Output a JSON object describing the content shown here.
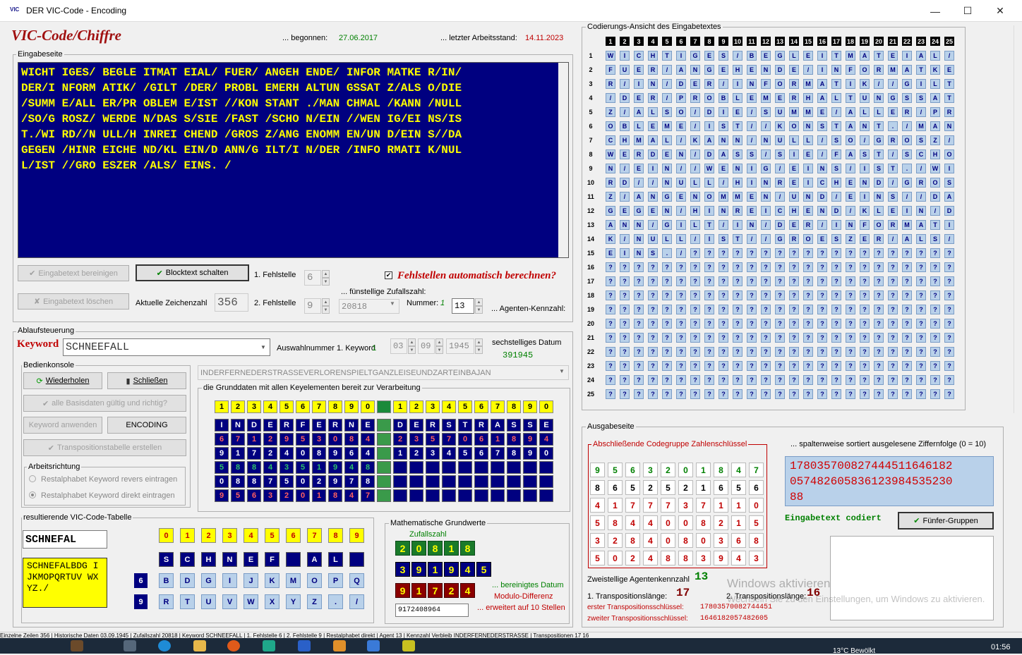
{
  "window": {
    "title": "DER VIC-Code - Encoding",
    "app_icon": "VIC",
    "minimize": "—",
    "maximize": "☐",
    "close": "✕"
  },
  "header": {
    "title": "VIC-Code/Chiffre",
    "begun_label": "... begonnen:",
    "begun_date": "27.06.2017",
    "last_label": "... letzter Arbeitsstand:",
    "last_date": "14.11.2023"
  },
  "input_page": {
    "label": "Eingabeseite",
    "lines": [
      "WICHT IGES/ BEGLE ITMAT EIAL/ FUER/ ANGEH ENDE/ INFOR MATKE R/IN/",
      "DER/I NFORM ATIK/ /GILT /DER/ PROBL EMERH ALTUN GSSAT Z/ALS O/DIE",
      "/SUMM E/ALL ER/PR OBLEM E/IST //KON STANT ./MAN CHMAL /KANN /NULL",
      "/SO/G ROSZ/ WERDE N/DAS S/SIE /FAST /SCHO N/EIN //WEN IG/EI NS/IS",
      "T./WI RD//N ULL/H INREI CHEND /GROS Z/ANG ENOMM EN/UN D/EIN S//DA",
      "GEGEN /HINR EICHE ND/KL EIN/D ANN/G ILT/I N/DER /INFO RMATI K/NUL",
      "L/IST //GRO ESZER /ALS/ EINS. /"
    ]
  },
  "controls": {
    "clean_btn": "Eingabetext bereinigen",
    "block_btn": "Blocktext schalten",
    "delete_btn": "Eingabetext löschen",
    "char_count_label": "Aktuelle Zeichenzahl",
    "char_count": "356",
    "err1_label": "1. Fehlstelle",
    "err1": "6",
    "err2_label": "2. Fehlstelle",
    "err2": "9",
    "auto_label": "Fehlstellen automatisch berechnen?",
    "random_label": "... fünstellige Zufallszahl:",
    "random": "20818",
    "number_label": "Nummer:",
    "number": "1",
    "agent_value": "13",
    "agent_label": "... Agenten-Kennzahl:"
  },
  "flow": {
    "label": "Ablaufsteuerung",
    "keyword_label": "Keyword",
    "keyword": "SCHNEEFALL",
    "auswahl_label": "Auswahlnummer 1. Keyword",
    "auswahl": "1",
    "date_d": "03",
    "date_m": "09",
    "date_y": "1945",
    "date6_label": "sechstelliges Datum",
    "date6": "391945"
  },
  "console": {
    "label": "Bedienkonsole",
    "repeat": "Wiederholen",
    "close": "Schließen",
    "valid": "alle Basisdaten gültig und richtig?",
    "apply": "Keyword anwenden",
    "encoding": "ENCODING",
    "transpose": "Transpositionstabelle erstellen",
    "dir_label": "Arbeitsrichtung",
    "radio1": "Restalphabet Keyword revers eintragen",
    "radio2": "Restalphabet Keyword direkt eintragen"
  },
  "phrase": "INDERFERNEDERSTRASSEVERLORENSPIELTGANZLEISEUNDZARTEINBAJAN",
  "grund": {
    "label": "die Grunddaten mit allen Keyelementen bereit zur Verarbeitung",
    "head": [
      "1",
      "2",
      "3",
      "4",
      "5",
      "6",
      "7",
      "8",
      "9",
      "0",
      "",
      "1",
      "2",
      "3",
      "4",
      "5",
      "6",
      "7",
      "8",
      "9",
      "0"
    ],
    "rows": [
      [
        "I",
        "N",
        "D",
        "E",
        "R",
        "F",
        "E",
        "R",
        "N",
        "E",
        "",
        "D",
        "E",
        "R",
        "S",
        "T",
        "R",
        "A",
        "S",
        "S",
        "E"
      ],
      [
        "6",
        "7",
        "1",
        "2",
        "9",
        "5",
        "3",
        "0",
        "8",
        "4",
        "",
        "2",
        "3",
        "5",
        "7",
        "0",
        "6",
        "1",
        "8",
        "9",
        "4"
      ],
      [
        "9",
        "1",
        "7",
        "2",
        "4",
        "0",
        "8",
        "9",
        "6",
        "4",
        "",
        "1",
        "2",
        "3",
        "4",
        "5",
        "6",
        "7",
        "8",
        "9",
        "0"
      ],
      [
        "5",
        "8",
        "8",
        "4",
        "3",
        "5",
        "1",
        "9",
        "4",
        "8",
        "",
        "",
        "",
        "",
        "",
        "",
        "",
        "",
        "",
        "",
        ""
      ],
      [
        "0",
        "8",
        "8",
        "7",
        "5",
        "0",
        "2",
        "9",
        "7",
        "8",
        "",
        "",
        "",
        "",
        "",
        "",
        "",
        "",
        "",
        "",
        ""
      ],
      [
        "9",
        "5",
        "6",
        "3",
        "2",
        "0",
        "1",
        "8",
        "4",
        "7",
        "",
        "",
        "",
        "",
        "",
        "",
        "",
        "",
        "",
        "",
        ""
      ]
    ]
  },
  "vic_table": {
    "label": "resultierende VIC-Code-Tabelle",
    "keyword": "SCHNEFAL",
    "alphabet": "SCHNEFALBDG IJKMOPQRTUV WXYZ./",
    "head": [
      "0",
      "1",
      "2",
      "3",
      "4",
      "5",
      "6",
      "7",
      "8",
      "9"
    ],
    "row0": [
      "S",
      "C",
      "H",
      "N",
      "E",
      "F",
      "",
      "A",
      "L",
      ""
    ],
    "row6_key": "6",
    "row6": [
      "B",
      "D",
      "G",
      "I",
      "J",
      "K",
      "M",
      "O",
      "P",
      "Q"
    ],
    "row9_key": "9",
    "row9": [
      "R",
      "T",
      "U",
      "V",
      "W",
      "X",
      "Y",
      "Z",
      ".",
      "/"
    ]
  },
  "math": {
    "label": "Mathematische Grundwerte",
    "zufall_label": "Zufallszahl",
    "zufall": [
      "2",
      "0",
      "8",
      "1",
      "8"
    ],
    "datum": [
      "3",
      "9",
      "1",
      "9",
      "4",
      "5"
    ],
    "datum_label": "... bereinigtes Datum",
    "modulo": [
      "9",
      "1",
      "7",
      "2",
      "4"
    ],
    "modulo_label": "Modulo-Differenz",
    "ext": "9172408964",
    "ext_label": "... erweitert auf 10 Stellen"
  },
  "coding": {
    "label": "Codierungs-Ansicht des Eingabetextes",
    "cols": [
      "1",
      "2",
      "3",
      "4",
      "5",
      "6",
      "7",
      "8",
      "9",
      "10",
      "11",
      "12",
      "13",
      "14",
      "15",
      "16",
      "17",
      "18",
      "19",
      "20",
      "21",
      "22",
      "23",
      "24",
      "25"
    ],
    "rows": [
      "WICHTIGES/BEGLEITMATEIAL/",
      "FUER/ANGEHENDE/INFORMATKE",
      "R/IN/DER/INFORMATIK//GILT",
      "/DER/PROBLEMERHALTUNGSSAT",
      "Z/ALSO/DIE/SUMME/ALLER/PR",
      "OBLEME/IST//KONSTANT./MAN",
      "CHMAL/KANN/NULL/SO/GROSZ/",
      "WERDEN/DASS/SIE/FAST/SCHO",
      "N/EIN//WENIG/EINS/IST./WI",
      "RD//NULL/HINREICHEND/GROS",
      "Z/ANGENOMMEN/UND/EINS//DA",
      "GEGEN/HINREICHEND/KLEIN/D",
      "ANN/GILT/IN/DER/INFORMATI",
      "K/NULL/IST//GROESZER/ALS/",
      "EINS./??????????????????",
      "?????????????????????????",
      "?????????????????????????",
      "?????????????????????????",
      "?????????????????????????",
      "?????????????????????????",
      "?????????????????????????",
      "?????????????????????????",
      "?????????????????????????",
      "?????????????????????????",
      "?????????????????????????"
    ]
  },
  "output": {
    "label": "Ausgabeseite",
    "final_label": "Abschließende Codegruppe Zahlenschlüssel",
    "matrix": [
      [
        "9",
        "5",
        "6",
        "3",
        "2",
        "0",
        "1",
        "8",
        "4",
        "7"
      ],
      [
        "8",
        "6",
        "5",
        "2",
        "5",
        "2",
        "1",
        "6",
        "5",
        "6"
      ],
      [
        "4",
        "1",
        "7",
        "7",
        "7",
        "3",
        "7",
        "1",
        "1",
        "0"
      ],
      [
        "5",
        "8",
        "4",
        "4",
        "0",
        "0",
        "8",
        "2",
        "1",
        "5"
      ],
      [
        "3",
        "2",
        "8",
        "4",
        "0",
        "8",
        "0",
        "3",
        "6",
        "8"
      ],
      [
        "5",
        "0",
        "2",
        "4",
        "8",
        "8",
        "3",
        "9",
        "4",
        "3"
      ]
    ],
    "sorted_label": "... spaltenweise sortiert ausgelesene Ziffernfolge (0 = 10)",
    "sorted_lines": [
      "178035700827444511646182",
      "057482605836123984535230",
      "88"
    ],
    "encoded": "Eingabetext codiert",
    "fives_btn": "Fünfer-Gruppen",
    "agent_label": "Zweistellige Agentenkennzahl",
    "agent": "13",
    "t1_label": "1. Transpositionslänge:",
    "t1": "17",
    "t2_label": "2. Transpositionslänge:",
    "t2": "16",
    "k1_label": "erster Transpositionsschlüssel:",
    "k1": "17803570082744451",
    "k2_label": "zweiter Transpositionsschlüssel:",
    "k2": "1646182057482605"
  },
  "watermark": {
    "line1": "Windows aktivieren",
    "line2": "Wechseln Sie zu den Einstellungen, um Windows zu aktivieren."
  },
  "status": [
    "Einzelne Zeilen",
    "356",
    "Historische Daten",
    "03.09.1945",
    "Zufallszahl",
    "20818",
    "Keyword",
    "SCHNEEFALL",
    "1. Fehlstelle",
    "6",
    "2. Fehlstelle",
    "9",
    "Restalphabet",
    "direkt",
    "Agent",
    "13",
    "Kennzahl Verbleib",
    "INDERFERNEDERSTRASSE",
    "Transpositionen",
    "17 16"
  ],
  "taskbar": {
    "weather": "13°C  Bewölkt",
    "time": "01:56"
  }
}
